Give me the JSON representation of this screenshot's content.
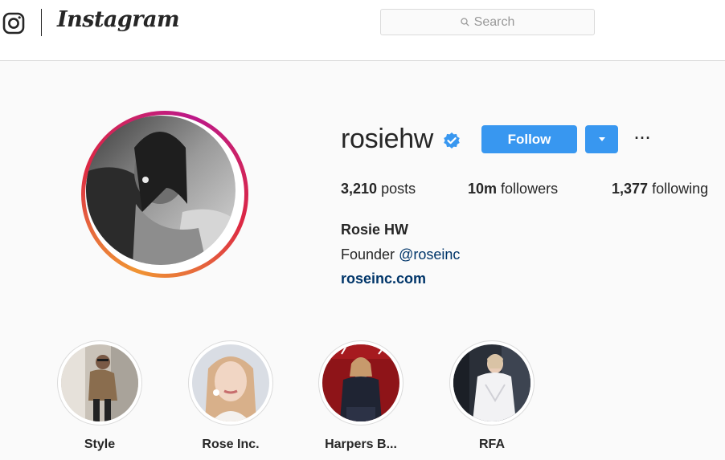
{
  "header": {
    "brand": "Instagram",
    "search_placeholder": "Search",
    "icons": [
      "instagram-camera-icon",
      "search-icon"
    ]
  },
  "profile": {
    "username": "rosiehw",
    "verified": true,
    "follow_label": "Follow",
    "more_label": "···",
    "posts_count": "3,210",
    "posts_label": "posts",
    "followers_count": "10m",
    "followers_label": "followers",
    "following_count": "1,377",
    "following_label": "following",
    "full_name": "Rosie HW",
    "bio_prefix": "Founder",
    "bio_mention": "@roseinc",
    "website": "roseinc.com"
  },
  "highlights": [
    {
      "label": "Style"
    },
    {
      "label": "Rose Inc."
    },
    {
      "label": "Harpers B..."
    },
    {
      "label": "RFA"
    }
  ],
  "colors": {
    "accent": "#3897f0",
    "link": "#003569",
    "verified": "#3897f0"
  }
}
